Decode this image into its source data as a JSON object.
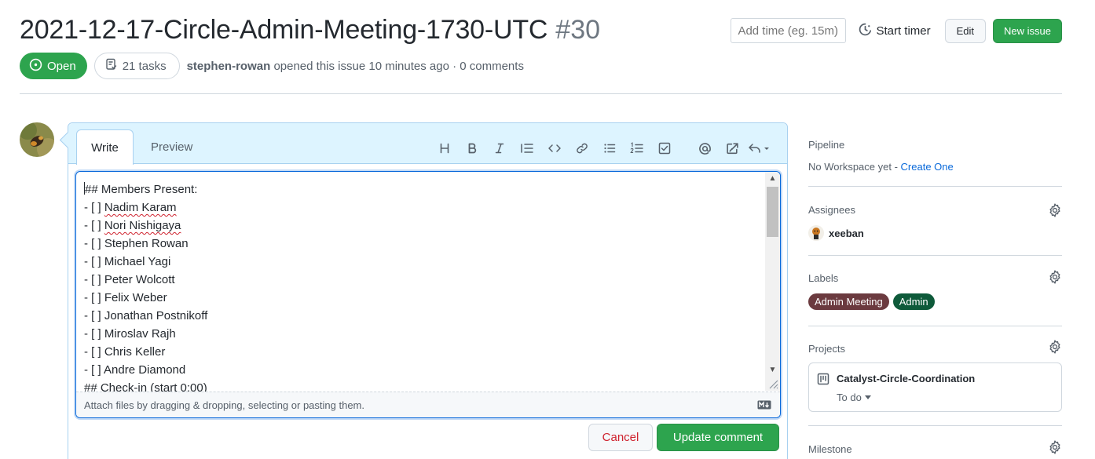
{
  "issue": {
    "title": "2021-12-17-Circle-Admin-Meeting-1730-UTC",
    "number": "#30",
    "state": "Open",
    "tasks": "21 tasks",
    "author": "stephen-rowan",
    "meta": "opened this issue 10 minutes ago · 0 comments"
  },
  "header_actions": {
    "time_placeholder": "Add time (eg. 15m)",
    "start_timer": "Start timer",
    "edit": "Edit",
    "new_issue": "New issue"
  },
  "editor": {
    "tab_write": "Write",
    "tab_preview": "Preview",
    "toolbar_icons": [
      "heading-icon",
      "bold-icon",
      "italic-icon",
      "quote-icon",
      "code-icon",
      "link-icon",
      "bulleted-list-icon",
      "numbered-list-icon",
      "task-list-icon",
      "mention-icon",
      "reference-icon",
      "reply-icon"
    ],
    "lines": [
      "## Members Present:",
      "- [ ] Nadim Karam",
      "- [ ] Nori Nishigaya",
      "- [ ] Stephen Rowan",
      "- [ ] Michael Yagi",
      "- [ ] Peter Wolcott",
      "- [ ] Felix Weber",
      "- [ ] Jonathan Postnikoff",
      "- [ ] Miroslav Rajh",
      "- [ ] Chris Keller",
      "- [ ] Andre Diamond",
      "## Check-in (start 0:00)"
    ],
    "attach_hint": "Attach files by dragging & dropping, selecting or pasting them.",
    "cancel": "Cancel",
    "update": "Update comment"
  },
  "sidebar": {
    "pipeline": {
      "heading": "Pipeline",
      "text": "No Workspace yet - ",
      "link": "Create One"
    },
    "assignees": {
      "heading": "Assignees",
      "user": "xeeban"
    },
    "labels": {
      "heading": "Labels",
      "items": [
        {
          "name": "Admin Meeting",
          "color": "#6b3a3f"
        },
        {
          "name": "Admin",
          "color": "#0e5a3a"
        }
      ]
    },
    "projects": {
      "heading": "Projects",
      "name": "Catalyst-Circle-Coordination",
      "column": "To do"
    },
    "milestone": {
      "heading": "Milestone"
    }
  },
  "colors": {
    "green": "#2da44e",
    "blue": "#0969da",
    "danger": "#cf222e"
  }
}
